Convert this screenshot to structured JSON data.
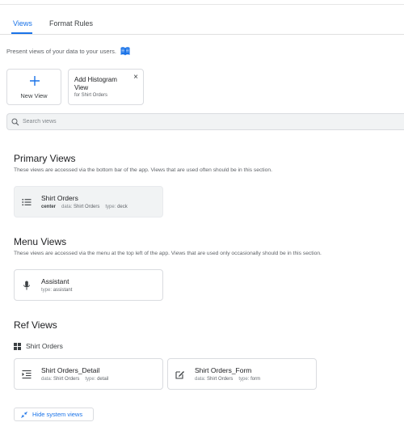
{
  "tabs": [
    {
      "label": "Views",
      "active": true
    },
    {
      "label": "Format Rules",
      "active": false
    }
  ],
  "intro_text": "Present views of your data to your users.",
  "new_view": {
    "label": "New View"
  },
  "suggestion": {
    "title": "Add Histogram View",
    "subtitle": "for Shirt Orders",
    "close": "×"
  },
  "search": {
    "placeholder": "Search views",
    "value": ""
  },
  "sections": {
    "primary": {
      "title": "Primary Views",
      "description": "These views are accessed via the bottom bar of the app. Views that are used often should be in this section.",
      "views": [
        {
          "name": "Shirt Orders",
          "position": "center",
          "data_label": "data:",
          "data": "Shirt Orders",
          "type_label": "type:",
          "type": "deck",
          "icon": "list-icon"
        }
      ]
    },
    "menu": {
      "title": "Menu Views",
      "description": "These views are accessed via the menu at the top left of the app. Views that are used only occasionally should be in this section.",
      "views": [
        {
          "name": "Assistant",
          "type_label": "type:",
          "type": "assistant",
          "icon": "microphone-icon"
        }
      ]
    },
    "ref": {
      "title": "Ref Views",
      "group_label": "Shirt Orders",
      "views": [
        {
          "name": "Shirt Orders_Detail",
          "data_label": "data:",
          "data": "Shirt Orders",
          "type_label": "type:",
          "type": "detail",
          "icon": "detail-icon"
        },
        {
          "name": "Shirt Orders_Form",
          "data_label": "data:",
          "data": "Shirt Orders",
          "type_label": "type:",
          "type": "form",
          "icon": "edit-icon"
        }
      ]
    }
  },
  "hide_system_views": "Hide system views",
  "colors": {
    "accent": "#1a73e8",
    "text": "#202124",
    "muted": "#5f6368",
    "card_shade": "#f1f3f4"
  }
}
